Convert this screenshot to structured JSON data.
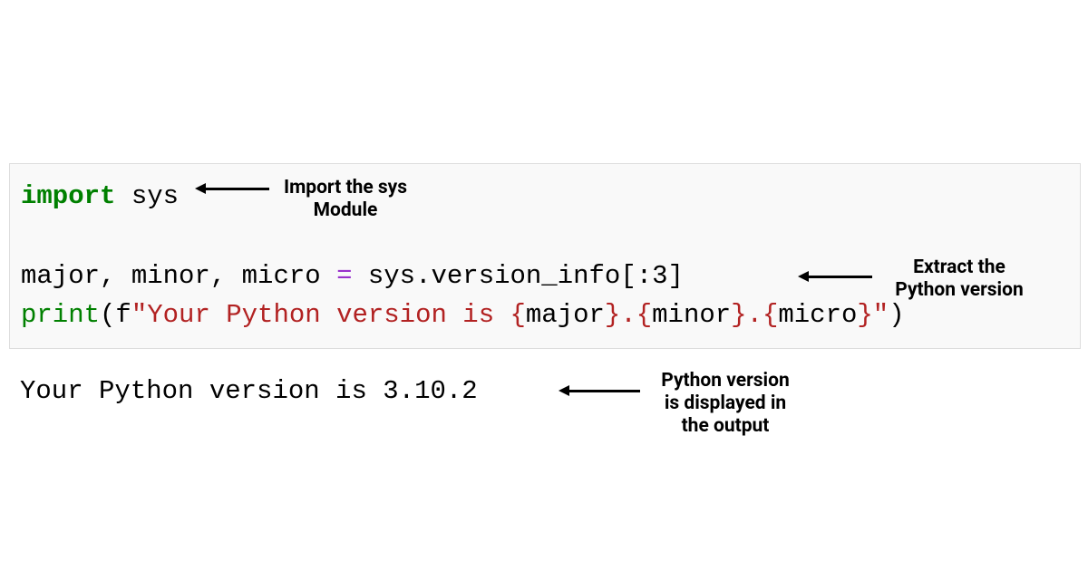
{
  "code": {
    "line1": {
      "import_kw": "import",
      "rest": " sys"
    },
    "line2": {
      "lhs": "major, minor, micro ",
      "op": "=",
      "rhs_pre": " sys.version_info[",
      "colon": ":",
      "rhs_post": "3]"
    },
    "line3": {
      "fn": "print",
      "open": "(f",
      "str_open_q": "\"",
      "str_text1": "Your Python version is ",
      "brace1o": "{",
      "var1": "major",
      "brace1c": "}",
      "dot1": ".",
      "brace2o": "{",
      "var2": "minor",
      "brace2c": "}",
      "dot2": ".",
      "brace3o": "{",
      "var3": "micro",
      "brace3c": "}",
      "str_close_q": "\"",
      "close": ")"
    }
  },
  "output": "Your Python version is 3.10.2",
  "annotations": {
    "a1_l1": "Import the sys",
    "a1_l2": "Module",
    "a2_l1": "Extract the",
    "a2_l2": "Python version",
    "a3_l1": "Python version",
    "a3_l2": "is displayed in",
    "a3_l3": "the output"
  }
}
